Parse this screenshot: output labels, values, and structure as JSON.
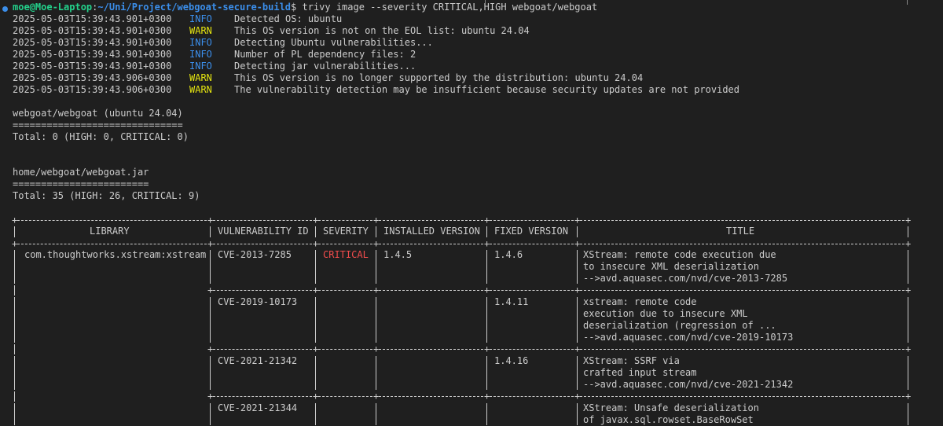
{
  "prompt": {
    "user_host": "moe@Moe-Laptop",
    "separator": ":",
    "path": "~/Uni/Project/webgoat-secure-build",
    "dollar": "$ ",
    "command": "trivy image --severity CRITICAL,HIGH webgoat/webgoat"
  },
  "log_lines": [
    {
      "ts": "2025-05-03T15:39:43.901+0300",
      "level": "INFO",
      "msg": "Detected OS: ubuntu"
    },
    {
      "ts": "2025-05-03T15:39:43.901+0300",
      "level": "WARN",
      "msg": "This OS version is not on the EOL list: ubuntu 24.04"
    },
    {
      "ts": "2025-05-03T15:39:43.901+0300",
      "level": "INFO",
      "msg": "Detecting Ubuntu vulnerabilities..."
    },
    {
      "ts": "2025-05-03T15:39:43.901+0300",
      "level": "INFO",
      "msg": "Number of PL dependency files: 2"
    },
    {
      "ts": "2025-05-03T15:39:43.901+0300",
      "level": "INFO",
      "msg": "Detecting jar vulnerabilities..."
    },
    {
      "ts": "2025-05-03T15:39:43.906+0300",
      "level": "WARN",
      "msg": "This OS version is no longer supported by the distribution: ubuntu 24.04"
    },
    {
      "ts": "2025-05-03T15:39:43.906+0300",
      "level": "WARN",
      "msg": "The vulnerability detection may be insufficient because security updates are not provided"
    }
  ],
  "os_section": {
    "target": "webgoat/webgoat (ubuntu 24.04)",
    "underline": "==============================",
    "total": "Total: 0 (HIGH: 0, CRITICAL: 0)"
  },
  "jar_section": {
    "target": "home/webgoat/webgoat.jar",
    "underline": "========================",
    "total": "Total: 35 (HIGH: 26, CRITICAL: 9)"
  },
  "table": {
    "headers": {
      "library": "LIBRARY",
      "vuln_id": "VULNERABILITY ID",
      "severity": "SEVERITY",
      "installed": "INSTALLED VERSION",
      "fixed": "FIXED VERSION",
      "title": "TITLE"
    },
    "library": "com.thoughtworks.xstream:xstream",
    "severity": "CRITICAL",
    "installed": "1.4.5",
    "rows": [
      {
        "vuln_id": "CVE-2013-7285",
        "fixed": "1.4.6",
        "title": [
          "XStream: remote code execution due",
          "to insecure XML deserialization",
          "-->avd.aquasec.com/nvd/cve-2013-7285"
        ]
      },
      {
        "vuln_id": "CVE-2019-10173",
        "fixed": "1.4.11",
        "title": [
          "xstream: remote code",
          "execution due to insecure XML",
          "deserialization (regression of ...",
          "-->avd.aquasec.com/nvd/cve-2019-10173"
        ]
      },
      {
        "vuln_id": "CVE-2021-21342",
        "fixed": "1.4.16",
        "title": [
          "XStream: SSRF via",
          "crafted input stream",
          "-->avd.aquasec.com/nvd/cve-2021-21342"
        ]
      },
      {
        "vuln_id": "CVE-2021-21344",
        "fixed": "",
        "title": [
          "XStream: Unsafe deserialization",
          "of javax.sql.rowset.BaseRowSet"
        ]
      }
    ]
  },
  "colors": {
    "background": "#1f1f1f",
    "text": "#cccccc",
    "info": "#3b8eea",
    "warn": "#e5e510",
    "critical": "#f14c4c",
    "user": "#23d18b"
  }
}
